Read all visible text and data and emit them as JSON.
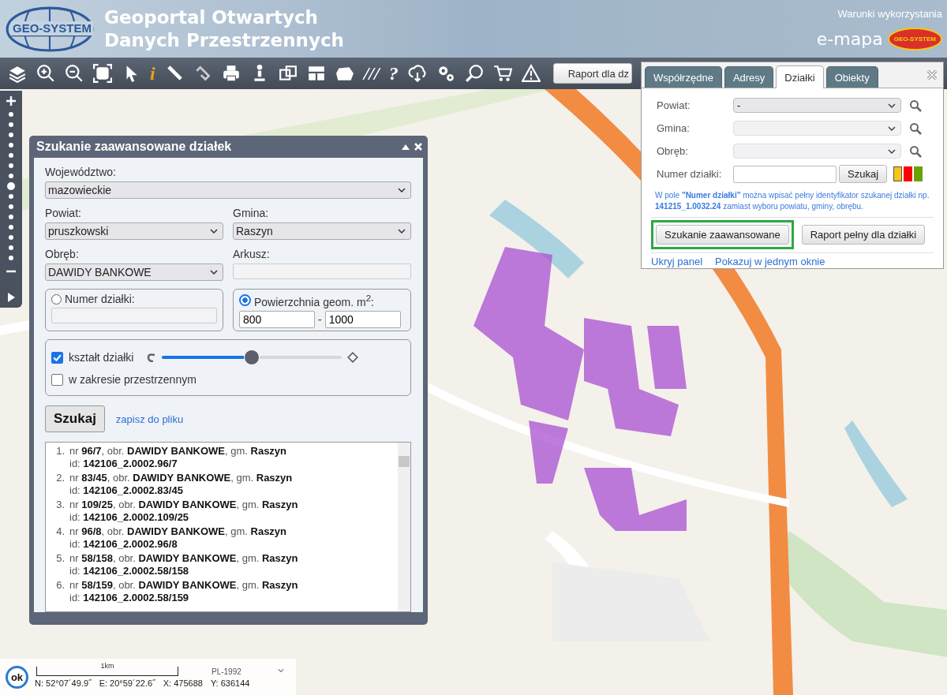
{
  "header": {
    "logo_text": "GEO-SYSTEM",
    "title_lines": [
      "Geoportal Otwartych",
      "Danych Przestrzennych"
    ],
    "terms_link": "Warunki wykorzystania",
    "brand": "e-mapa",
    "brand_badge": "GEO-SYSTEM"
  },
  "toolbar": {
    "tools": [
      {
        "kind": "layers"
      },
      {
        "kind": "zoom-in"
      },
      {
        "kind": "zoom-out"
      },
      {
        "kind": "extent"
      },
      {
        "kind": "pointer"
      },
      {
        "kind": "glyph",
        "glyph": "i",
        "color": "#e8a317"
      },
      {
        "kind": "ruler"
      },
      {
        "kind": "link"
      },
      {
        "kind": "print"
      },
      {
        "kind": "pin"
      },
      {
        "kind": "copy"
      },
      {
        "kind": "layout"
      },
      {
        "kind": "shape"
      },
      {
        "kind": "glyph",
        "glyph": "///",
        "color": "#ffffff"
      },
      {
        "kind": "glyph",
        "glyph": "?",
        "color": "#ffffff"
      },
      {
        "kind": "cloud"
      },
      {
        "kind": "gears"
      },
      {
        "kind": "find"
      },
      {
        "kind": "cart"
      },
      {
        "kind": "warning"
      }
    ],
    "report_button": "Raport dla dz"
  },
  "zoom_bar": {
    "level": 0.5
  },
  "search_panel": {
    "tabs": [
      {
        "label": "Współrzędne",
        "selected": false
      },
      {
        "label": "Adresy",
        "selected": false
      },
      {
        "label": "Działki",
        "selected": true
      },
      {
        "label": "Obiekty",
        "selected": false
      }
    ],
    "fields": [
      {
        "label": "Powiat:",
        "value": "-",
        "disabled": false
      },
      {
        "label": "Gmina:",
        "disabled": true
      },
      {
        "label": "Obręb:",
        "disabled": true
      }
    ],
    "number_label": "Numer działki:",
    "search_button": "Szukaj",
    "swatches": [
      {
        "color": "#f5c518",
        "selected": true
      },
      {
        "color": "#ff0000",
        "selected": false
      },
      {
        "color": "#66a300",
        "selected": false
      }
    ],
    "hint": "W pole **\"Numer działki\"** można wpisać pełny identyfikator szukanej działki np. **141215_1.0032.24** zamiast wyboru powiatu, gminy, obrębu.",
    "buttons": [
      {
        "label": "Szukanie zaawansowane",
        "highlighted": true
      },
      {
        "label": "Raport pełny dla działki",
        "highlighted": false
      }
    ],
    "links": [
      "Ukryj panel",
      "Pokazuj w jednym oknie"
    ]
  },
  "dialog": {
    "title": "Szukanie zaawansowane działek",
    "voivodeship": {
      "label": "Województwo:",
      "value": "mazowieckie"
    },
    "county": {
      "label": "Powiat:",
      "value": "pruszkowski"
    },
    "commune": {
      "label": "Gmina:",
      "value": "Raszyn"
    },
    "precinct": {
      "label": "Obręb:",
      "value": "DAWIDY BANKOWE"
    },
    "sheet": {
      "label": "Arkusz:"
    },
    "modes": [
      {
        "kind": "number",
        "label": "Numer działki:",
        "selected": false
      },
      {
        "kind": "area",
        "label": "Powierzchnia geom. m$^{2}$:",
        "selected": true,
        "from": "800",
        "separator": "-",
        "to": "1000"
      }
    ],
    "options": [
      {
        "kind": "slider",
        "label": "kształt działki",
        "checked": true,
        "level": 0.5
      },
      {
        "kind": "check",
        "label": "w zakresie przestrzennym",
        "checked": false
      }
    ],
    "search_button": "Szukaj",
    "save_link": "zapisz do pliku",
    "results": [
      {
        "number": "1.",
        "line": "nr **96/7**, obr. **DAWIDY BANKOWE**, gm. **Raszyn**",
        "id": "id: **142106_2.0002.96/7**"
      },
      {
        "number": "2.",
        "line": "nr **83/45**, obr. **DAWIDY BANKOWE**, gm. **Raszyn**",
        "id": "id: **142106_2.0002.83/45**"
      },
      {
        "number": "3.",
        "line": "nr **109/25**, obr. **DAWIDY BANKOWE**, gm. **Raszyn**",
        "id": "id: **142106_2.0002.109/25**"
      },
      {
        "number": "4.",
        "line": "nr **96/8**, obr. **DAWIDY BANKOWE**, gm. **Raszyn**",
        "id": "id: **142106_2.0002.96/8**"
      },
      {
        "number": "5.",
        "line": "nr **58/158**, obr. **DAWIDY BANKOWE**, gm. **Raszyn**",
        "id": "id: **142106_2.0002.58/158**"
      },
      {
        "number": "6.",
        "line": "nr **58/159**, obr. **DAWIDY BANKOWE**, gm. **Raszyn**",
        "id": "id: **142106_2.0002.58/159**"
      }
    ]
  },
  "status_bar": {
    "ok_button": "ok",
    "scale": "1km",
    "crs": "PL-1992",
    "coords": [
      "N: 52°07´49.9˝",
      "E: 20°59´22.6˝",
      "X: 475688",
      "Y: 636144"
    ]
  }
}
